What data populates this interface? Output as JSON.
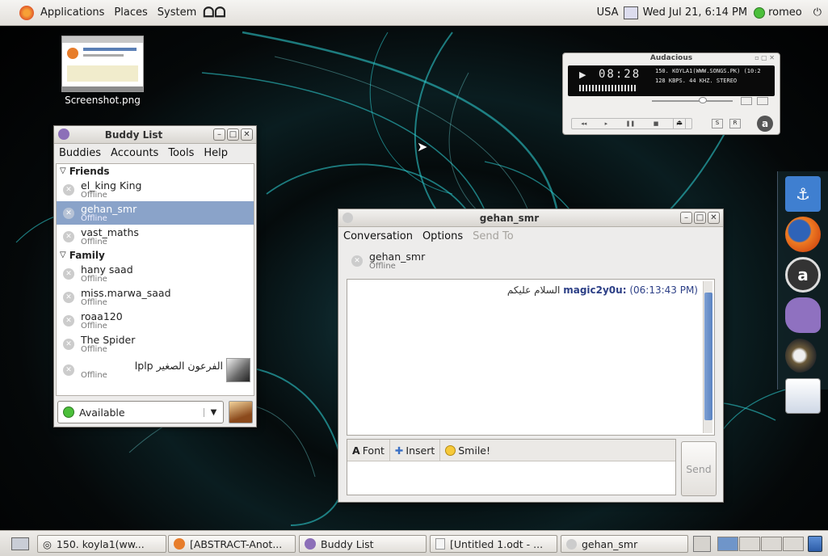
{
  "colors": {
    "selection": "#8aa3c9",
    "available": "#4bbf3a",
    "chat_nick": "#2c3f86"
  },
  "top_panel": {
    "menus": [
      "Applications",
      "Places",
      "System"
    ],
    "keyboard": "USA",
    "clock": "Wed Jul 21,  6:14 PM",
    "user": "romeo"
  },
  "desktop_icon": {
    "label": "Screenshot.png"
  },
  "buddy_list": {
    "title": "Buddy List",
    "menus": [
      "Buddies",
      "Accounts",
      "Tools",
      "Help"
    ],
    "groups": [
      {
        "name": "Friends",
        "buddies": [
          {
            "name": "el_king King",
            "status": "Offline"
          },
          {
            "name": "gehan_smr",
            "status": "Offline",
            "selected": true
          },
          {
            "name": "vast_maths",
            "status": "Offline"
          }
        ]
      },
      {
        "name": "Family",
        "buddies": [
          {
            "name": "hany saad",
            "status": "Offline"
          },
          {
            "name": "miss.marwa_saad",
            "status": "Offline"
          },
          {
            "name": "roaa120",
            "status": "Offline"
          },
          {
            "name": "The Spider",
            "status": "Offline"
          },
          {
            "name": "الفرعون الصغير lplp",
            "status": "Offline",
            "avatar": true
          }
        ]
      }
    ],
    "status": "Available"
  },
  "audio_player": {
    "logo": "Audacious",
    "time": "08:28",
    "track": "150. KOYLA1(WWW.SONGS.PK) (10:2",
    "info": "128 KBPS. 44 KHZ. STEREO",
    "btn_s": "S",
    "btn_r": "R"
  },
  "chat": {
    "title": "gehan_smr",
    "menus": [
      "Conversation",
      "Options",
      "Send To"
    ],
    "buddy_name": "gehan_smr",
    "buddy_status": "Offline",
    "messages": [
      {
        "nick": "magic2y0u:",
        "time": "(06:13:43 PM)",
        "text": "السلام عليكم"
      }
    ],
    "toolbar": {
      "font": "Font",
      "insert": "Insert",
      "smile": "Smile!"
    },
    "send": "Send"
  },
  "taskbar": {
    "tasks": [
      "150. koyla1(ww...",
      "[ABSTRACT-Anot...",
      "Buddy List",
      "[Untitled 1.odt - ...",
      "gehan_smr"
    ]
  }
}
